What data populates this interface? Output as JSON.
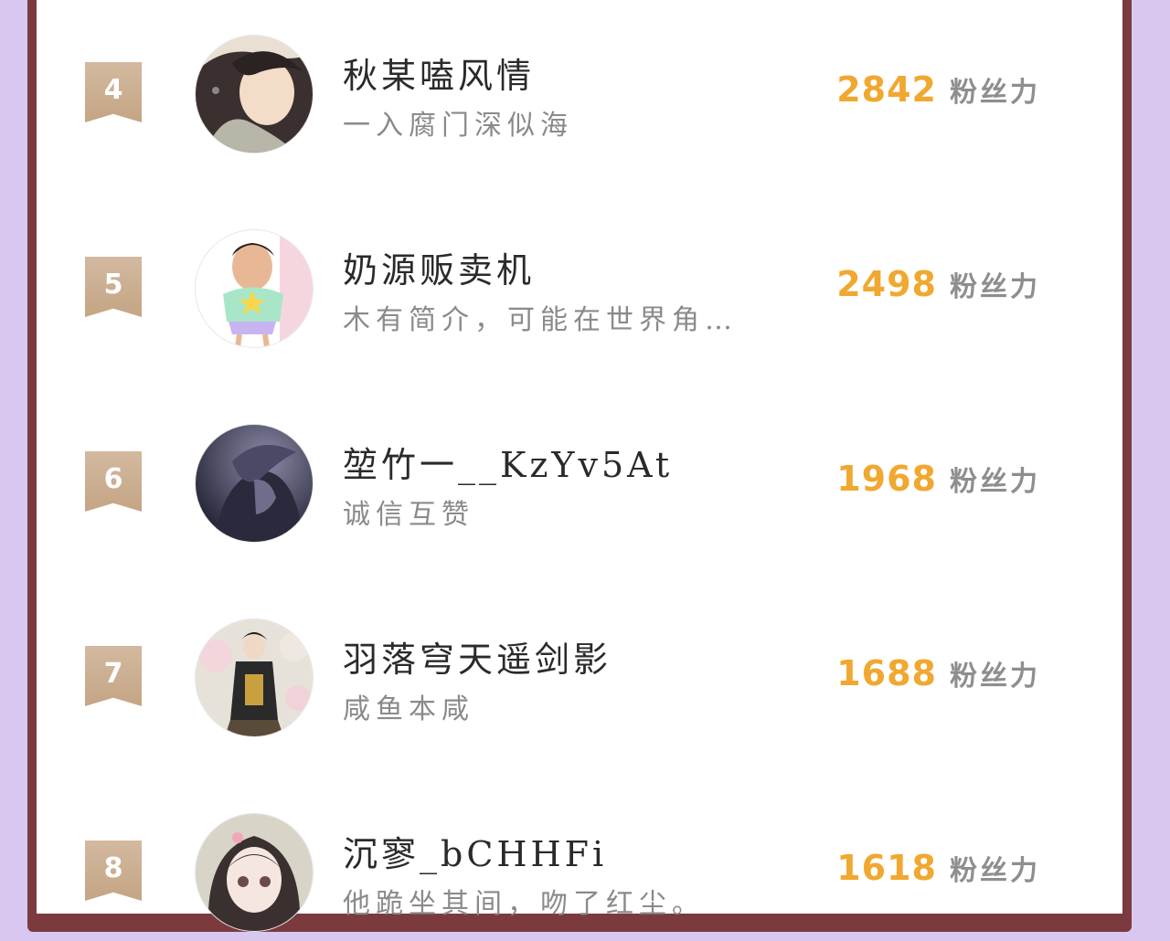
{
  "leaderboard": {
    "entries": [
      {
        "rank": "4",
        "name": "秋某嗑风情",
        "bio": "一入腐门深似海",
        "score": "2842",
        "score_unit": "粉丝力",
        "avatar_icon": "anime-avatar-icon"
      },
      {
        "rank": "5",
        "name": "奶源贩卖机",
        "bio": "木有简介，可能在世界角…",
        "score": "2498",
        "score_unit": "粉丝力",
        "avatar_icon": "cartoon-avatar-icon"
      },
      {
        "rank": "6",
        "name": "堃竹一__KzYv5At",
        "bio": "诚信互赞",
        "score": "1968",
        "score_unit": "粉丝力",
        "avatar_icon": "dark-portrait-avatar-icon"
      },
      {
        "rank": "7",
        "name": "羽落穹天遥剑影",
        "bio": "咸鱼本咸",
        "score": "1688",
        "score_unit": "粉丝力",
        "avatar_icon": "warrior-avatar-icon"
      },
      {
        "rank": "8",
        "name": "沉寥_bCHHFi",
        "bio": "他跪坐其间，吻了红尘。",
        "score": "1618",
        "score_unit": "粉丝力",
        "avatar_icon": "girl-avatar-icon"
      }
    ]
  }
}
